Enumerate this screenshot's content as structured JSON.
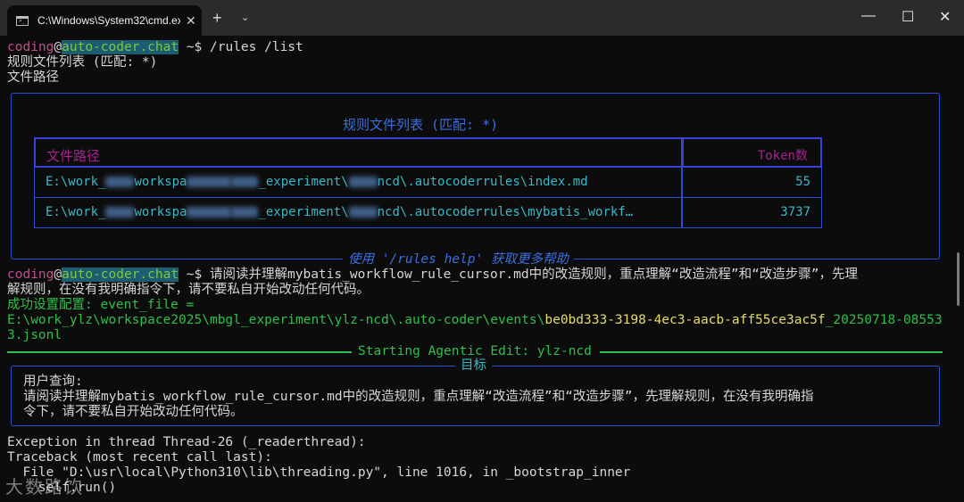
{
  "window": {
    "tab_title": "C:\\Windows\\System32\\cmd.ex",
    "tab_icon": "terminal-icon",
    "close_tab_glyph": "✕",
    "new_tab_glyph": "+",
    "dropdown_glyph": "⌄",
    "minimize_glyph": "—",
    "maximize_glyph": "☐",
    "close_glyph": "✕"
  },
  "prompt": {
    "user": "coding",
    "at": "@",
    "host": "auto-coder.chat",
    "suffix": " ~$ "
  },
  "lines": {
    "cmd1": "/rules /list",
    "l1": "规则文件列表 (匹配: *)",
    "l2": "文件路径",
    "table_title": "规则文件列表 (匹配: *)",
    "help_hint": "使用 '/rules help' 获取更多帮助",
    "cmd2a": "请阅读并理解mybatis_workflow_rule_cursor.md中的改造规则，重点理解“改造流程”和“改造步骤”，先理",
    "cmd2b": "解规则，在没有我明确指令下，请不要私自开始改动任何代码。",
    "cfg1": "成功设置配置: event_file =",
    "cfg2_path": "E:\\work_ylz\\workspace2025\\mbgl_experiment\\ylz-ncd\\.auto-coder\\events\\",
    "cfg2_id": "be0bd333-3198-4ec3-aacb-aff55ce3ac5f",
    "cfg2_tail": "_20250718-08553",
    "cfg3": "3.jsonl",
    "agentic": "Starting Agentic Edit: ylz-ncd",
    "goal": "目标",
    "query_label": "用户查询:",
    "query1": "请阅读并理解mybatis_workflow_rule_cursor.md中的改造规则，重点理解“改造流程”和“改造步骤”，先理解规则，在没有我明确指",
    "query2": "令下，请不要私自开始改动任何代码。",
    "exc1": "Exception in thread Thread-26 (_readerthread):",
    "exc2": "Traceback (most recent call last):",
    "exc3": "  File \"D:\\usr\\local\\Python310\\lib\\threading.py\", line 1016, in _bootstrap_inner",
    "exc4": "    self.run()"
  },
  "table": {
    "headers": [
      "文件路径",
      "Token数"
    ],
    "rows": [
      {
        "p1": "E:\\work_",
        "p2": "workspa",
        "p3": "_experiment\\",
        "p4": "ncd\\.autocoderrules\\index.md",
        "tokens": "55"
      },
      {
        "p1": "E:\\work_",
        "p2": "workspa",
        "p3": "_experiment\\",
        "p4": "ncd\\.autocoderrules\\mybatis_workf…",
        "tokens": "3737"
      }
    ]
  },
  "watermark": "大数路饮",
  "colors": {
    "background": "#0c0c0c",
    "prompt_user": "#c0508e",
    "prompt_host": "#7ec73d",
    "border": "#2a4fd0",
    "success": "#2fbf4a"
  }
}
